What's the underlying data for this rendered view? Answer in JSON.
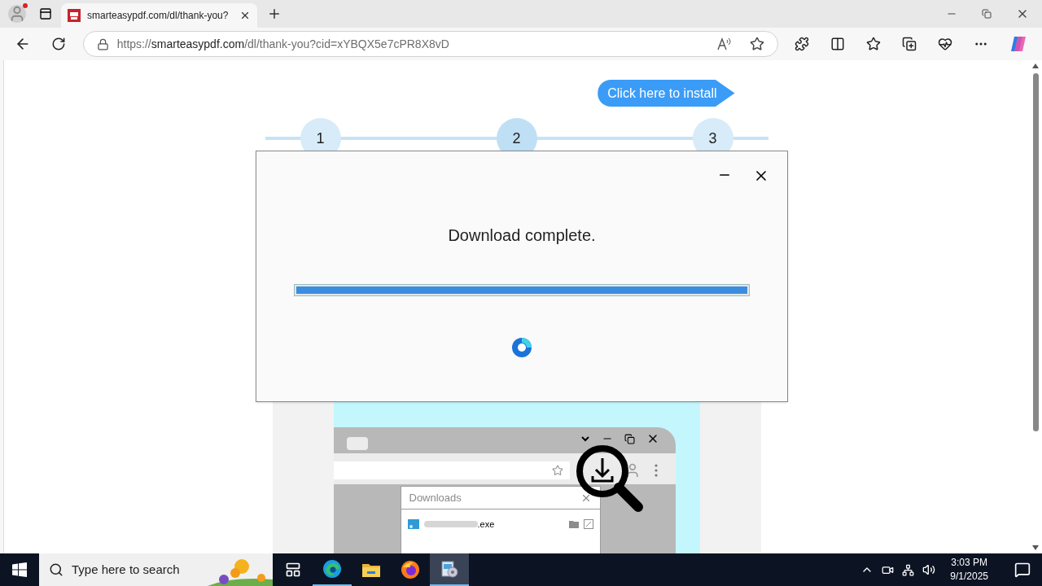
{
  "browser": {
    "tab": {
      "title": "smarteasypdf.com/dl/thank-you?"
    },
    "url": {
      "scheme": "https://",
      "host": "smarteasypdf.com",
      "path": "/dl/thank-you?cid=xYBQX5e7cPR8X8vD"
    }
  },
  "page": {
    "install_button": "Click here to install",
    "steps": [
      {
        "label": "1",
        "selected": false
      },
      {
        "label": "2",
        "selected": true
      },
      {
        "label": "3",
        "selected": false
      }
    ],
    "dialog": {
      "message": "Download complete.",
      "level": 1
    },
    "illustration": {
      "panel_title": "Downloads",
      "file_name": ".exe"
    }
  },
  "taskbar": {
    "search_placeholder": "Type here to search",
    "apps": [
      {
        "kind": "task-view",
        "running": false,
        "selected": false
      },
      {
        "kind": "edge",
        "running": true,
        "selected": false
      },
      {
        "kind": "explorer",
        "running": false,
        "selected": false
      },
      {
        "kind": "firefox",
        "running": false,
        "selected": false
      },
      {
        "kind": "installer",
        "running": true,
        "selected": true
      }
    ],
    "time": "3:03 PM",
    "date": "9/1/2025"
  }
}
